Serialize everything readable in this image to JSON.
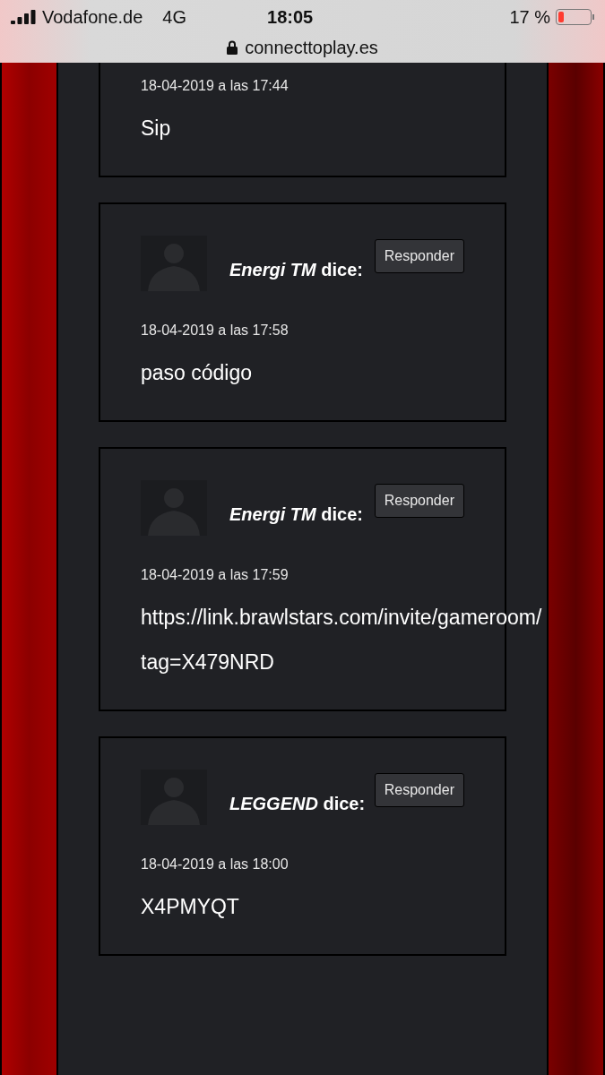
{
  "status_bar": {
    "carrier": "Vodafone.de",
    "network": "4G",
    "time": "18:05",
    "battery": "17 %",
    "url": "connecttoplay.es"
  },
  "comments": [
    {
      "date": "18-04-2019 a las 17:44",
      "lines": [
        "Sip"
      ]
    },
    {
      "author": "Energi TM",
      "says": "dice:",
      "reply": "Responder",
      "date": "18-04-2019 a las 17:58",
      "lines": [
        "paso código"
      ]
    },
    {
      "author": "Energi TM",
      "says": "dice:",
      "reply": "Responder",
      "date": "18-04-2019 a las 17:59",
      "lines": [
        "https://link.brawlstars.com/invite/gameroom/",
        "tag=X479NRD"
      ]
    },
    {
      "author": "LEGGEND",
      "says": "dice:",
      "reply": "Responder",
      "date": "18-04-2019 a las 18:00",
      "lines": [
        "X4PMYQT"
      ]
    }
  ]
}
